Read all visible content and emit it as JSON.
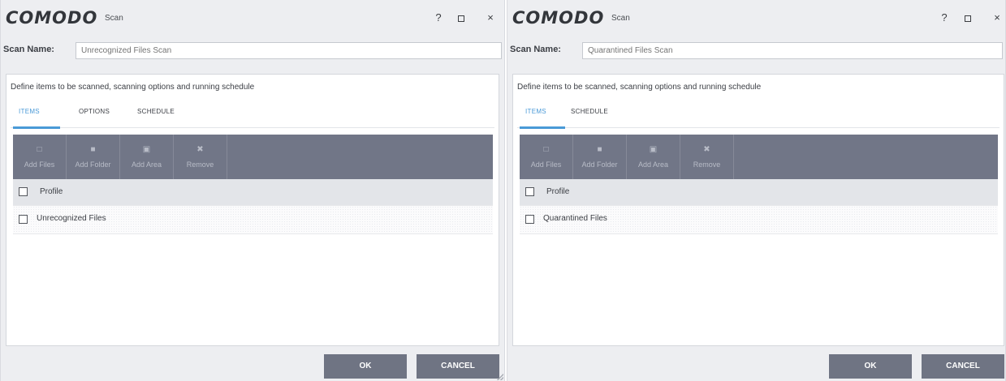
{
  "dialogs": [
    {
      "logo": "COMODO",
      "subtitle": "Scan",
      "help_label": "?",
      "close_label": "×",
      "scan_name_label": "Scan Name:",
      "scan_name_placeholder": "Unrecognized Files Scan",
      "description": "Define items to be scanned, scanning options and running schedule",
      "tabs": [
        "ITEMS",
        "OPTIONS",
        "SCHEDULE"
      ],
      "active_tab": "ITEMS",
      "toolbar": [
        {
          "label": "Add Files",
          "icon": "add-file-icon"
        },
        {
          "label": "Add Folder",
          "icon": "add-folder-icon"
        },
        {
          "label": "Add Area",
          "icon": "add-area-icon"
        },
        {
          "label": "Remove",
          "icon": "remove-icon"
        }
      ],
      "column_header": "Profile",
      "rows": [
        "Unrecognized Files"
      ],
      "ok_label": "OK",
      "cancel_label": "CANCEL"
    },
    {
      "logo": "COMODO",
      "subtitle": "Scan",
      "help_label": "?",
      "close_label": "×",
      "scan_name_label": "Scan Name:",
      "scan_name_placeholder": "Quarantined Files Scan",
      "description": "Define items to be scanned, scanning options and running schedule",
      "tabs": [
        "ITEMS",
        "SCHEDULE"
      ],
      "active_tab": "ITEMS",
      "toolbar": [
        {
          "label": "Add Files",
          "icon": "add-file-icon"
        },
        {
          "label": "Add Folder",
          "icon": "add-folder-icon"
        },
        {
          "label": "Add Area",
          "icon": "add-area-icon"
        },
        {
          "label": "Remove",
          "icon": "remove-icon"
        }
      ],
      "column_header": "Profile",
      "rows": [
        "Quarantined Files"
      ],
      "ok_label": "OK",
      "cancel_label": "CANCEL"
    }
  ],
  "colors": {
    "accent": "#4a9ad7",
    "toolbar": "#717687",
    "button": "#6f7483",
    "background": "#edeef1"
  }
}
